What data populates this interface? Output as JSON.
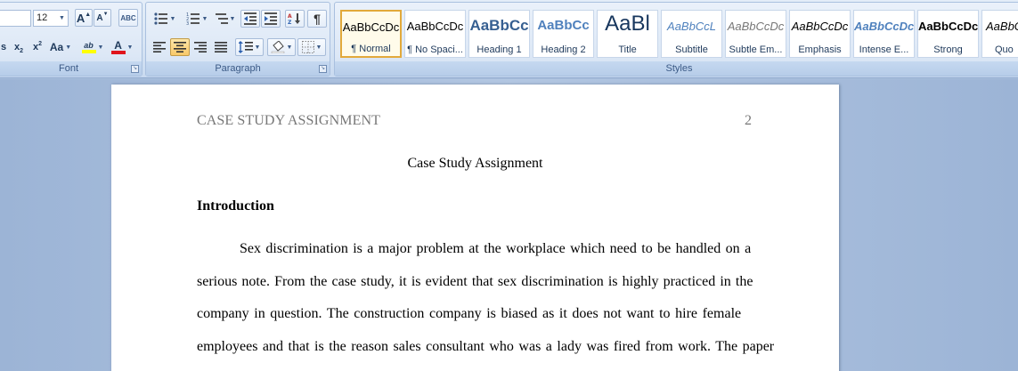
{
  "ribbon": {
    "font_group": {
      "label": "Font",
      "font_size": "12",
      "grow_font": "A",
      "shrink_font": "A",
      "clear_formatting": "ABC",
      "subscript": "x",
      "superscript": "x",
      "change_case": "Aa",
      "highlight": "ab",
      "font_color": "A"
    },
    "paragraph_group": {
      "label": "Paragraph"
    },
    "styles_group": {
      "label": "Styles",
      "items": [
        {
          "sample": "AaBbCcDc",
          "name": "¶ Normal"
        },
        {
          "sample": "AaBbCcDc",
          "name": "¶ No Spaci..."
        },
        {
          "sample": "AaBbCc",
          "name": "Heading 1"
        },
        {
          "sample": "AaBbCc",
          "name": "Heading 2"
        },
        {
          "sample": "AaBl",
          "name": "Title"
        },
        {
          "sample": "AaBbCcL",
          "name": "Subtitle"
        },
        {
          "sample": "AaBbCcDc",
          "name": "Subtle Em..."
        },
        {
          "sample": "AaBbCcDc",
          "name": "Emphasis"
        },
        {
          "sample": "AaBbCcDc",
          "name": "Intense E..."
        },
        {
          "sample": "AaBbCcDc",
          "name": "Strong"
        },
        {
          "sample": "AaBbCc",
          "name": "Quo"
        }
      ]
    }
  },
  "document": {
    "header_title": "CASE STUDY ASSIGNMENT",
    "page_number": "2",
    "title": "Case Study Assignment",
    "heading": "Introduction",
    "paragraph_lines": [
      "Sex discrimination is a major problem at the workplace which need to be handled on a",
      "serious note. From the case study, it is evident that sex discrimination is highly practiced in the",
      "company in question. The construction company is biased as it does not want to hire female",
      "employees and that is the reason sales consultant who was a lady was fired from work. The paper"
    ]
  },
  "colors": {
    "ribbon_text": "#1e395b",
    "group_label": "#3b5a86",
    "selected_style_border": "#e2a93b",
    "header_text": "#777777",
    "workspace": "#a9bfdc"
  }
}
